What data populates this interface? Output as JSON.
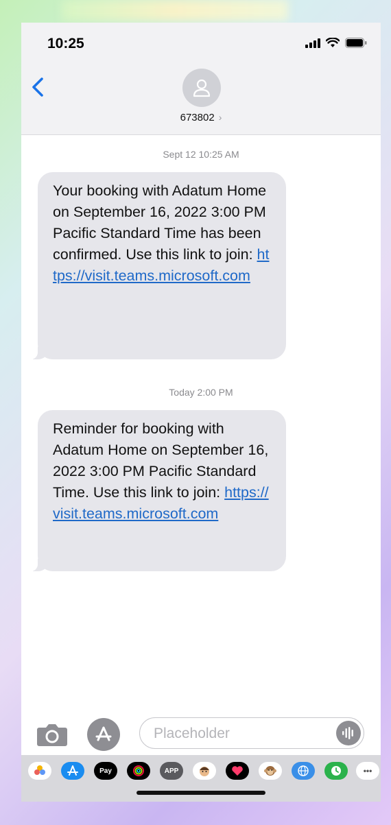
{
  "status_bar": {
    "time": "10:25"
  },
  "header": {
    "contact_number": "673802",
    "chevron": "›"
  },
  "messages": [
    {
      "timestamp": "Sept 12 10:25 AM",
      "text": "Your booking with Adatum Home on September 16, 2022 3:00 PM Pacific Standard Time has been confirmed. Use this link to join: ",
      "link": "https://visit.teams.microsoft.com"
    },
    {
      "timestamp": "Today 2:00 PM",
      "text": "Reminder for booking with Adatum Home on September 16, 2022 3:00 PM Pacific Standard Time. Use this link to join: ",
      "link": "https://visit.teams.microsoft.com"
    }
  ],
  "composer": {
    "placeholder": "Placeholder"
  },
  "tray": {
    "apple_pay_label": "Pay",
    "app_label": "APP",
    "more_label": "•••",
    "apps": [
      "photos-icon",
      "app-store-icon",
      "apple-pay-icon",
      "activity-icon",
      "app-icon",
      "memoji-icon",
      "heart-icon",
      "monkey-icon",
      "globe-icon",
      "clock-icon",
      "more-icon"
    ]
  },
  "colors": {
    "link": "#1f69c8",
    "bubble": "#e6e6eb",
    "accent": "#1a73e8"
  }
}
